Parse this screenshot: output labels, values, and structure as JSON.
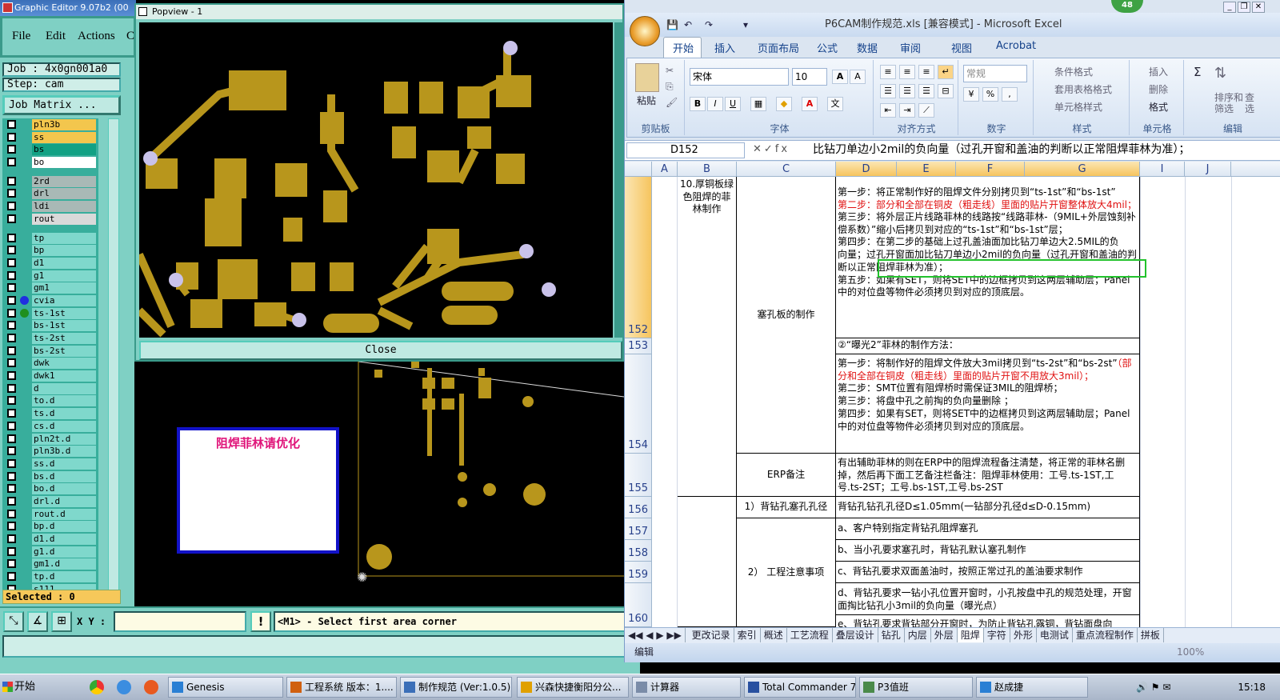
{
  "graphic_editor": {
    "title": "Graphic Editor 9.07b2 (00",
    "menu": [
      "File",
      "Edit",
      "Actions",
      "C"
    ],
    "job": "Job : 4x0gn001a0",
    "step": "Step: cam",
    "job_matrix": "Job Matrix ...",
    "layers": [
      {
        "name": "pln3b",
        "color": "#f3c64d"
      },
      {
        "name": "ss",
        "color": "#f3c64d"
      },
      {
        "name": "bs",
        "color": "#12a184"
      },
      {
        "name": "bo",
        "color": "#ffffff"
      },
      {
        "sep": true
      },
      {
        "name": "2rd",
        "color": "#a9b9b6"
      },
      {
        "name": "drl",
        "color": "#a9b9b6"
      },
      {
        "name": "ldi",
        "color": "#a9b9b6"
      },
      {
        "name": "rout",
        "color": "#d9d9d9"
      },
      {
        "sep": true
      },
      {
        "name": "tp"
      },
      {
        "name": "bp"
      },
      {
        "name": "d1",
        "mark": "✎"
      },
      {
        "name": "g1"
      },
      {
        "name": "gm1"
      },
      {
        "name": "cvia",
        "dot": "#1f2fe0"
      },
      {
        "name": "ts-1st",
        "dot": "#1f8f1f"
      },
      {
        "name": "bs-1st"
      },
      {
        "name": "ts-2st"
      },
      {
        "name": "bs-2st"
      },
      {
        "name": "dwk"
      },
      {
        "name": "dwk1"
      },
      {
        "name": "d"
      },
      {
        "name": "to.d",
        "mark": "✎"
      },
      {
        "name": "ts.d"
      },
      {
        "name": "cs.d"
      },
      {
        "name": "pln2t.d"
      },
      {
        "name": "pln3b.d"
      },
      {
        "name": "ss.d"
      },
      {
        "name": "bs.d"
      },
      {
        "name": "bo.d"
      },
      {
        "name": "drl.d"
      },
      {
        "name": "rout.d"
      },
      {
        "name": "bp.d"
      },
      {
        "name": "d1.d",
        "mark": "✎"
      },
      {
        "name": "g1.d"
      },
      {
        "name": "gm1.d"
      },
      {
        "name": "tp.d"
      },
      {
        "name": "s111"
      }
    ],
    "selected": "Selected : 0",
    "xy_label": "X Y :",
    "xy_value": "",
    "warn": "!",
    "status": "<M1> - Select first area corner",
    "note_box_text": "阻焊菲林请优化"
  },
  "popview": {
    "title": "Popview - 1",
    "close": "Close"
  },
  "excel": {
    "title": "P6CAM制作规范.xls  [兼容模式] - Microsoft Excel",
    "badge": "48",
    "tabs": [
      "开始",
      "插入",
      "页面布局",
      "公式",
      "数据",
      "审阅",
      "视图",
      "Acrobat"
    ],
    "ribbon": {
      "paste": "粘贴",
      "clipboard": "剪贴板",
      "font_name": "宋体",
      "font_size": "10",
      "font": "字体",
      "align": "对齐方式",
      "number_format": "常规",
      "number": "数字",
      "cond_format": "条件格式",
      "table_format": "套用表格格式",
      "cell_style": "单元格样式",
      "styles": "样式",
      "insert": "插入",
      "delete": "删除",
      "format": "格式",
      "cells": "单元格",
      "sort_filter": "排序和\n筛选",
      "find": "查\n选",
      "edit": "编辑"
    },
    "name_box": "D152",
    "formula": "比钻刀单边小2mil的负向量（过孔开窗和盖油的判断以正常阻焊菲林为准）；",
    "columns": [
      "A",
      "B",
      "C",
      "D",
      "E",
      "F",
      "G",
      "I",
      "J"
    ],
    "rows": [
      "152",
      "153",
      "154",
      "155",
      "156",
      "157",
      "158",
      "159",
      "160"
    ],
    "cells": {
      "b_top": "10.厚铜板绿色阻焊的菲林制作",
      "c152": "塞孔板的制作",
      "d152_1": "第一步：将正常制作好的阻焊文件分别拷贝到“ts-1st”和“bs-1st”",
      "d152_2": "第二步：部分和全部在铜皮（粗走线）里面的贴片开窗整体放大4mil；",
      "d152_3": "第三步：将外层正片线路菲林的线路按“线路菲林-（9MIL+外层蚀刻补偿系数）”缩小后拷贝到对应的“ts-1st”和“bs-1st”层；",
      "d152_4a": "第四步：",
      "d152_4b": "在第二步的基础上过孔盖油面加比钻刀单边大2.5MIL的负",
      "d152_4c": "向量；过孔开窗面加比钻刀单边小2mil的负向量（过孔开窗和盖油的判断以正常阻焊菲林为准）；",
      "d152_5": "第五步：如果有SET，则将SET中的边框拷贝到这两层辅助层；Panel中的对位盘等物件必须拷贝到对应的顶底层。",
      "d153": "②“曝光2”菲林的制作方法：",
      "d154_1a": "第一步：将制作好的阻焊文件放大3mil拷贝到“ts-2st”和“bs-2st”",
      "d154_1b": "（部分和全部在铜皮（粗走线）里面的贴片开窗不用放大3mil）；",
      "d154_2": "第二步：SMT位置有阻焊桥时需保证3MIL的阻焊桥；",
      "d154_3": "第三步：将盘中孔之前掏的负向量删除 ；",
      "d154_4": "第四步：如果有SET，则将SET中的边框拷贝到这两层辅助层；Panel中的对位盘等物件必须拷贝到对应的顶底层。",
      "c155": "ERP备注",
      "d155": "有出辅助菲林的则在ERP中的阻焊流程备注清楚，将正常的菲林名删掉，然后再下面工艺备注栏备注：阻焊菲林使用：工号.ts-1ST,工号.ts-2ST；工号.bs-1ST,工号.bs-2ST",
      "c156": "1）背钻孔塞孔孔径",
      "d156": "背钻孔钻孔孔径D≤1.05mm(一钻部分孔径d≤D-0.15mm)",
      "c160": "2） 工程注意事项",
      "d157": "a、客户特别指定背钻孔阻焊塞孔",
      "d158": "b、当小孔要求塞孔时，背钻孔默认塞孔制作",
      "d159": "c、背钻孔要求双面盖油时，按照正常过孔的盖油要求制作",
      "d160": "d、背钻孔要求一钻小孔位置开窗时，小孔按盘中孔的规范处理，开窗面掏比钻孔小3mil的负向量（曝光点）",
      "d161": "e、背钻孔要求背钻部分开窗时，为防止背钻孔露铜，背钻面盘向"
    },
    "sheet_tabs": [
      "更改记录",
      "索引",
      "概述",
      "工艺流程",
      "叠层设计",
      "钻孔",
      "内层",
      "外层",
      "阻焊",
      "字符",
      "外形",
      "电测试",
      "重点流程制作",
      "拼板"
    ],
    "active_sheet": "阻焊",
    "status": "编辑",
    "zoom": "100%"
  },
  "taskbar": {
    "start": "开始",
    "tasks": [
      "Genesis",
      "工程系统  版本：1....",
      "制作规范 (Ver:1.0.5)",
      "兴森快捷衡阳分公...",
      "计算器",
      "Total Commander 7.0...",
      "P3值班",
      "赵成捷"
    ],
    "clock": "15:18"
  }
}
